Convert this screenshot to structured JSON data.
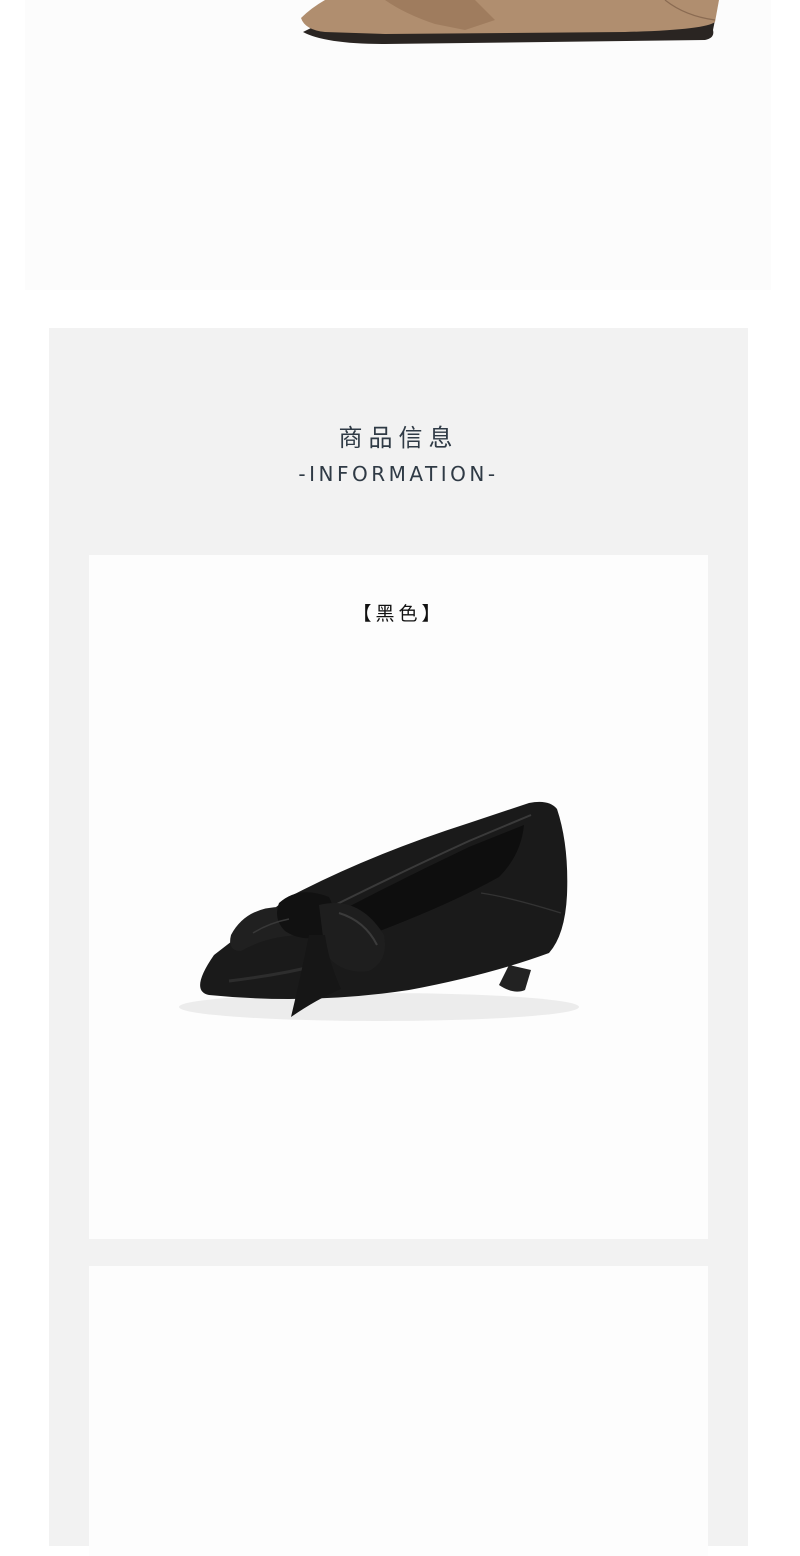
{
  "info": {
    "title": "商品信息",
    "subtitle": "-INFORMATION-"
  },
  "cards": [
    {
      "color_label": "【黑色】",
      "shoe_color": "#1a1a1a"
    },
    {
      "color_label": ""
    }
  ],
  "top_image": {
    "shoe_color": "#b08e6f"
  },
  "colors": {
    "section_bg": "#f2f2f2",
    "card_bg": "#fdfdfd",
    "title_text": "#2f3a45"
  }
}
